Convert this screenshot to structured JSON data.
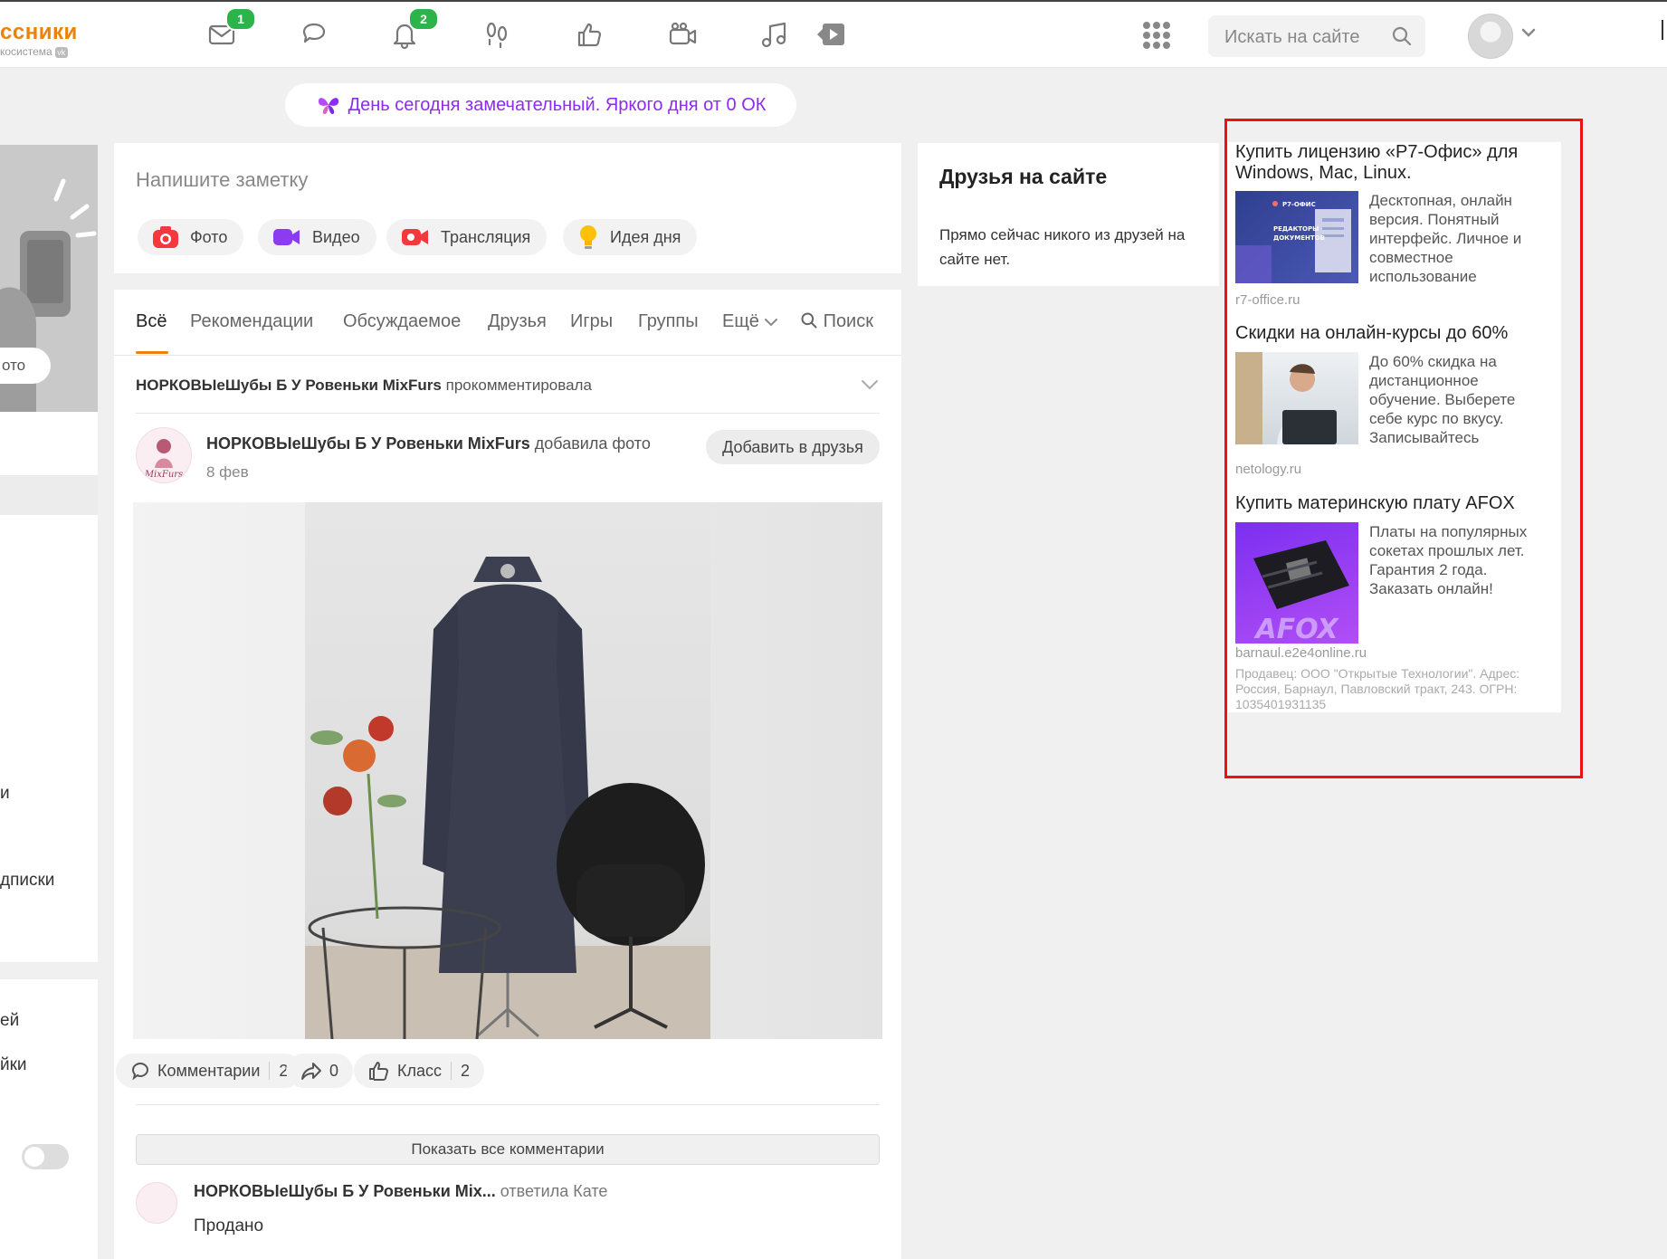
{
  "header": {
    "logo_text": "ссники",
    "logo_sub": "косистема",
    "logo_vk": "vk",
    "nav": [
      {
        "name": "messages",
        "icon": "envelope-icon",
        "badge": "1"
      },
      {
        "name": "discussions",
        "icon": "speech-bubbles-icon",
        "badge": ""
      },
      {
        "name": "notifications",
        "icon": "bell-icon",
        "badge": "2"
      },
      {
        "name": "guests",
        "icon": "footprints-icon",
        "badge": ""
      },
      {
        "name": "events",
        "icon": "thumbs-up-icon",
        "badge": ""
      },
      {
        "name": "video",
        "icon": "camera-icon",
        "badge": ""
      },
      {
        "name": "music",
        "icon": "music-note-icon",
        "badge": ""
      },
      {
        "name": "play",
        "icon": "play-icon",
        "badge": ""
      }
    ],
    "search_placeholder": "Искать на сайте",
    "badge_color": "#2cb34a",
    "accent": "#ee8208"
  },
  "greeting": {
    "icon": "butterfly-icon",
    "text": "День сегодня замечательный. Яркого дня от 0 ОК",
    "color": "#8b2cf0"
  },
  "left": {
    "photo_button": "ото",
    "menu_items": [
      "и",
      "дписки"
    ],
    "bottom_items": [
      "ей",
      "йки"
    ]
  },
  "composer": {
    "placeholder": "Напишите заметку",
    "chips": [
      {
        "label": "Фото",
        "icon": "camera-icon"
      },
      {
        "label": "Видео",
        "icon": "video-camera-icon"
      },
      {
        "label": "Трансляция",
        "icon": "broadcast-icon"
      },
      {
        "label": "Идея дня",
        "icon": "lightbulb-icon"
      }
    ]
  },
  "feed": {
    "tabs": [
      "Всё",
      "Рекомендации",
      "Обсуждаемое",
      "Друзья",
      "Игры",
      "Группы",
      "Ещё",
      "Поиск"
    ],
    "notice_author": "НОРКОВЫеШубы Б У Ровеньки MixFurs",
    "notice_action": "прокомментировала",
    "post": {
      "author": "НОРКОВЫеШубы Б У Ровеньки MixFurs",
      "action": "добавила фото",
      "date": "8 фев",
      "add_friend": "Добавить в друзья",
      "avatar_text": "MixFurs",
      "comments_label": "Комментарии",
      "comments_count": "2",
      "shares_count": "0",
      "likes_label": "Класс",
      "likes_count": "2"
    },
    "show_all_comments": "Показать все комментарии",
    "comment": {
      "author": "НОРКОВЫеШубы Б У Ровеньки Mix...",
      "action": "ответила Кате",
      "text": "Продано"
    }
  },
  "friends_online": {
    "title": "Друзья на сайте",
    "text": "Прямо сейчас никого из друзей на сайте нет."
  },
  "ads": [
    {
      "title": "Купить лицензию «Р7-Офис» для Windows, Mac, Linux.",
      "text": "Десктопная, онлайн версия. Понятный интерфейс. Личное и совместное использование",
      "domain": "r7-office.ru",
      "image_text": "Р7-ОФИС\nРЕДАКТОРЫ\nДОКУМЕНТОВ"
    },
    {
      "title": "Скидки на онлайн-курсы до 60%",
      "text": "До 60% скидка на дистанционное обучение. Выберете себе курс по вкусу. Записывайтесь",
      "domain": "netology.ru"
    },
    {
      "title": "Купить материнскую плату AFOX",
      "text": "Платы на популярных сокетах прошлых лет. Гарантия 2 года. Заказать онлайн!",
      "domain": "barnaul.e2e4online.ru",
      "image_text": "AFOX"
    }
  ],
  "ads_seller": "Продавец: ООО \"Открытые Технологии\". Адрес: Россия, Барнаул, Павловский тракт, 243. ОГРН: 1035401931135"
}
